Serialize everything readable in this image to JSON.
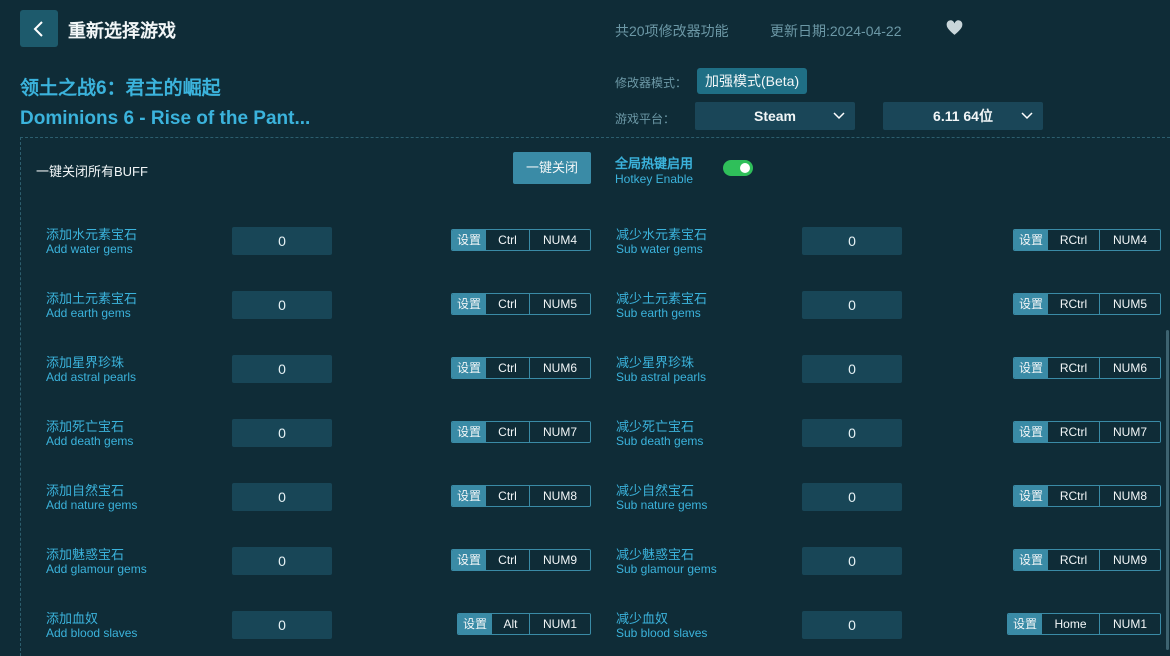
{
  "header": {
    "back_icon": "chevron-left-icon",
    "title": "重新选择游戏",
    "function_count": "共20项修改器功能",
    "update_date": "更新日期:2024-04-22",
    "favorite_icon": "heart-icon"
  },
  "game": {
    "title_cn": "领土之战6：君主的崛起",
    "title_en": "Dominions 6 - Rise of the Pant..."
  },
  "settings": {
    "mode_label": "修改器模式：",
    "mode_value": "加强模式(Beta)",
    "platform_label": "游戏平台：",
    "platform_value": "Steam",
    "version_value": "6.11 64位"
  },
  "controls": {
    "buff_label": "一键关闭所有BUFF",
    "close_all_button": "一键关闭",
    "hotkey_cn": "全局热键启用",
    "hotkey_en": "Hotkey Enable",
    "hotkey_enabled": true
  },
  "cheats_left": [
    {
      "cn": "添加水元素宝石",
      "en": "Add water gems",
      "value": "0",
      "set": "设置",
      "mod": "Ctrl",
      "key": "NUM4"
    },
    {
      "cn": "添加土元素宝石",
      "en": "Add earth gems",
      "value": "0",
      "set": "设置",
      "mod": "Ctrl",
      "key": "NUM5"
    },
    {
      "cn": "添加星界珍珠",
      "en": "Add astral pearls",
      "value": "0",
      "set": "设置",
      "mod": "Ctrl",
      "key": "NUM6"
    },
    {
      "cn": "添加死亡宝石",
      "en": "Add death gems",
      "value": "0",
      "set": "设置",
      "mod": "Ctrl",
      "key": "NUM7"
    },
    {
      "cn": "添加自然宝石",
      "en": "Add nature gems",
      "value": "0",
      "set": "设置",
      "mod": "Ctrl",
      "key": "NUM8"
    },
    {
      "cn": "添加魅惑宝石",
      "en": "Add glamour gems",
      "value": "0",
      "set": "设置",
      "mod": "Ctrl",
      "key": "NUM9"
    },
    {
      "cn": "添加血奴",
      "en": "Add blood slaves",
      "value": "0",
      "set": "设置",
      "mod": "Alt",
      "key": "NUM1"
    }
  ],
  "cheats_right": [
    {
      "cn": "减少水元素宝石",
      "en": "Sub water gems",
      "value": "0",
      "set": "设置",
      "mod": "RCtrl",
      "key": "NUM4"
    },
    {
      "cn": "减少土元素宝石",
      "en": "Sub earth gems",
      "value": "0",
      "set": "设置",
      "mod": "RCtrl",
      "key": "NUM5"
    },
    {
      "cn": "减少星界珍珠",
      "en": "Sub astral pearls",
      "value": "0",
      "set": "设置",
      "mod": "RCtrl",
      "key": "NUM6"
    },
    {
      "cn": "减少死亡宝石",
      "en": "Sub death gems",
      "value": "0",
      "set": "设置",
      "mod": "RCtrl",
      "key": "NUM7"
    },
    {
      "cn": "减少自然宝石",
      "en": "Sub nature gems",
      "value": "0",
      "set": "设置",
      "mod": "RCtrl",
      "key": "NUM8"
    },
    {
      "cn": "减少魅惑宝石",
      "en": "Sub glamour gems",
      "value": "0",
      "set": "设置",
      "mod": "RCtrl",
      "key": "NUM9"
    },
    {
      "cn": "减少血奴",
      "en": "Sub blood slaves",
      "value": "0",
      "set": "设置",
      "mod": "Home",
      "key": "NUM1"
    }
  ],
  "colors": {
    "background": "#0f2c37",
    "accent": "#3bb3dc",
    "button": "#3a8ba6",
    "toggle_on": "#2fbf5a"
  }
}
